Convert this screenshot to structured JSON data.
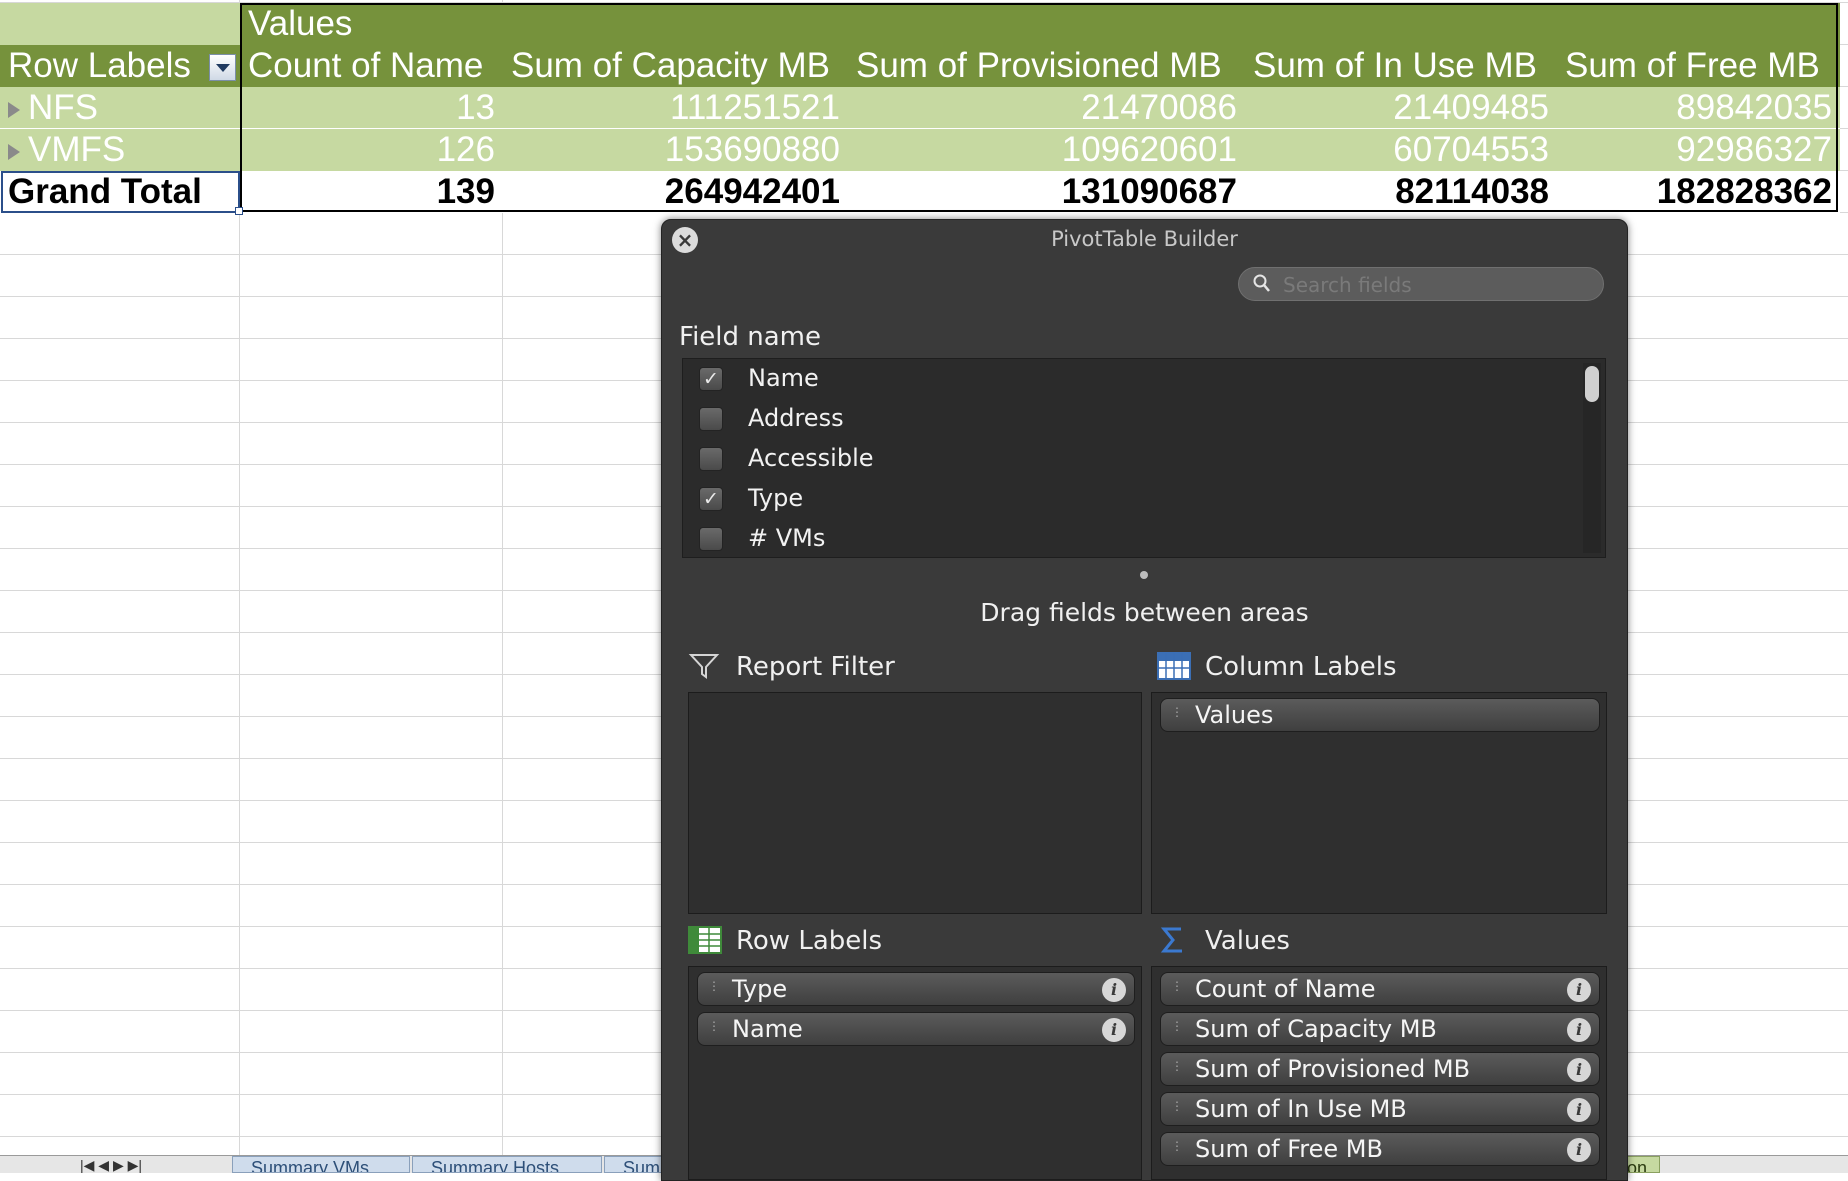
{
  "pivot": {
    "values_header": "Values",
    "column_headers": [
      "Row Labels",
      "Count of Name",
      "Sum of Capacity MB",
      "Sum of Provisioned MB",
      "Sum of In Use MB",
      "Sum of Free MB"
    ],
    "rows": [
      {
        "label": "NFS",
        "cells": [
          "13",
          "111251521",
          "21470086",
          "21409485",
          "89842035"
        ]
      },
      {
        "label": "VMFS",
        "cells": [
          "126",
          "153690880",
          "109620601",
          "60704553",
          "92986327"
        ]
      }
    ],
    "grand_total": {
      "label": "Grand Total",
      "cells": [
        "139",
        "264942401",
        "131090687",
        "82114038",
        "182828362"
      ]
    },
    "colors": {
      "header_bg": "#76923c",
      "row_bg": "#c6d9a1",
      "grid": "#d8d8d8"
    }
  },
  "sheet_tabs": {
    "nav": "|◀ ◀ ▶ ▶|",
    "tabs": [
      "Summary VMs",
      "Summary Hosts",
      "Sum"
    ],
    "right_tab": "tion"
  },
  "builder": {
    "title": "PivotTable Builder",
    "search_placeholder": "Search fields",
    "field_name_label": "Field name",
    "fields": [
      {
        "label": "Name",
        "checked": true
      },
      {
        "label": "Address",
        "checked": false
      },
      {
        "label": "Accessible",
        "checked": false
      },
      {
        "label": "Type",
        "checked": true
      },
      {
        "label": "# VMs",
        "checked": false
      }
    ],
    "drag_hint": "Drag fields between areas",
    "areas": {
      "report_filter": {
        "title": "Report Filter",
        "icon": "funnel-icon",
        "items": []
      },
      "column_labels": {
        "title": "Column Labels",
        "icon": "column-grid-icon",
        "items": [
          "Values"
        ]
      },
      "row_labels": {
        "title": "Row Labels",
        "icon": "row-grid-icon",
        "items": [
          "Type",
          "Name"
        ]
      },
      "values": {
        "title": "Values",
        "icon": "sigma-icon",
        "items": [
          "Count of Name",
          "Sum of Capacity MB",
          "Sum of Provisioned MB",
          "Sum of In Use MB",
          "Sum of Free MB"
        ]
      }
    },
    "colors": {
      "panel_bg": "#3a3a3a",
      "box_bg": "#2f2f2f"
    }
  }
}
